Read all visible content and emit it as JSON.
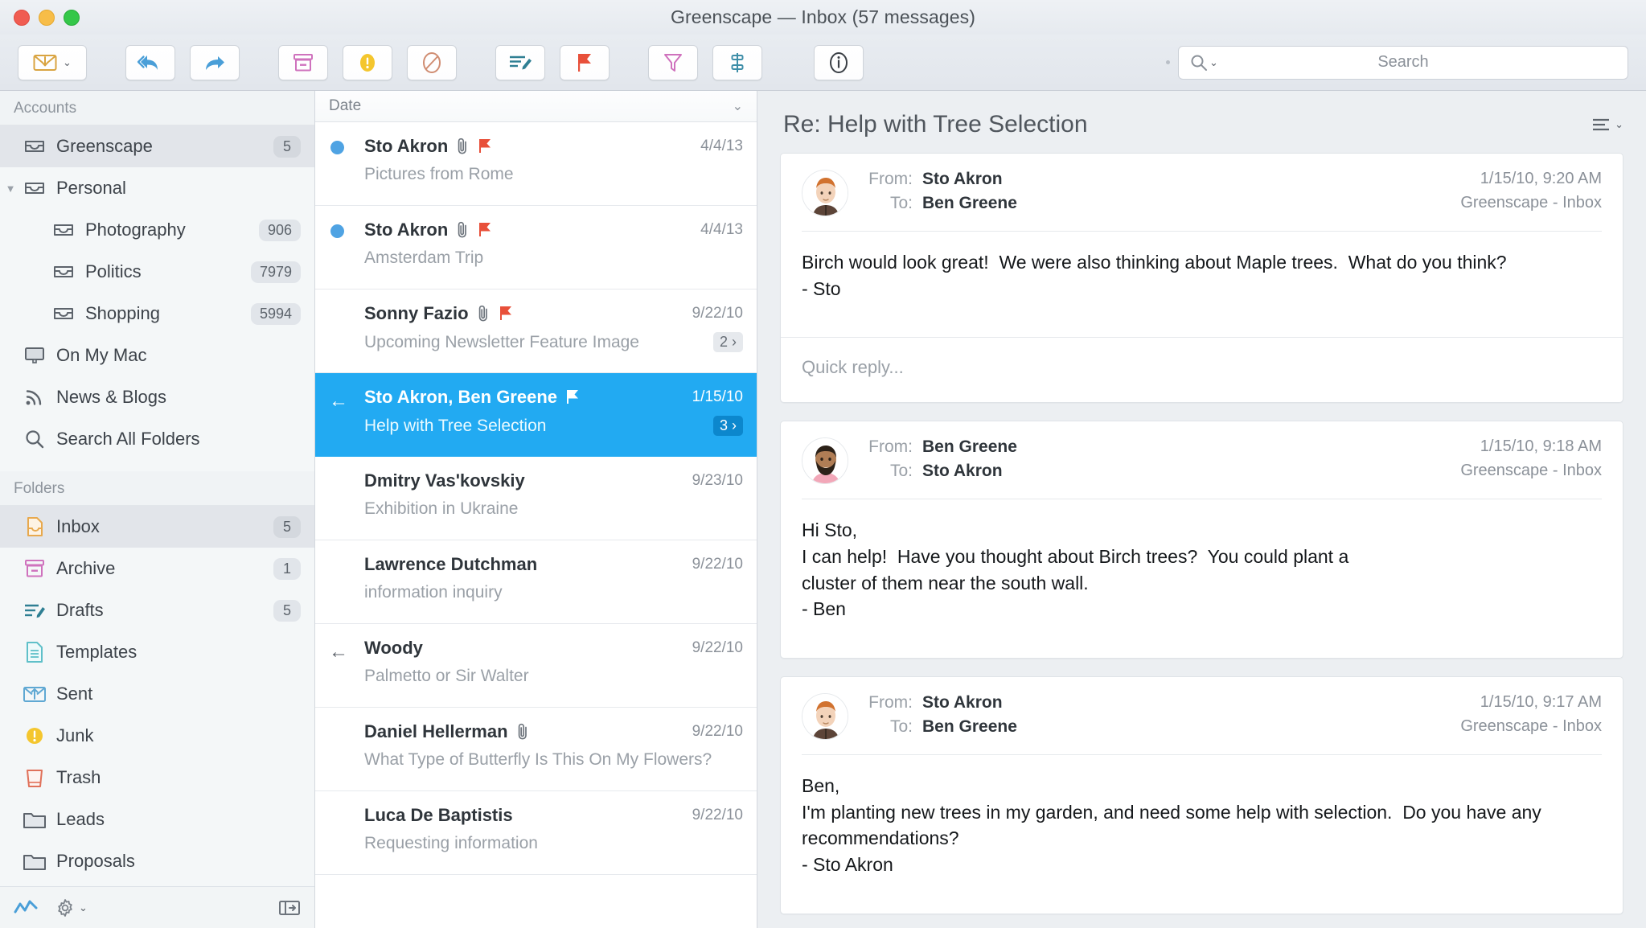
{
  "window": {
    "title": "Greenscape — Inbox (57 messages)",
    "accent_selected": "#22aaf2",
    "traffic": {
      "close": "close-button",
      "minimize": "minimize-button",
      "zoom": "zoom-button"
    }
  },
  "toolbar": {
    "buttons": [
      {
        "name": "get-mail",
        "icon": "envelope-download-icon",
        "has_chevron": true
      },
      {
        "name": "reply-all",
        "icon": "reply-all-icon"
      },
      {
        "name": "forward",
        "icon": "forward-arrow-icon"
      },
      {
        "name": "archive",
        "icon": "archive-box-icon"
      },
      {
        "name": "junk",
        "icon": "junk-warning-icon"
      },
      {
        "name": "block",
        "icon": "block-circle-icon"
      },
      {
        "name": "compose",
        "icon": "compose-pencil-icon"
      },
      {
        "name": "flag",
        "icon": "red-flag-icon"
      },
      {
        "name": "filter",
        "icon": "funnel-filter-icon"
      },
      {
        "name": "sort-threads",
        "icon": "thread-sort-icon"
      },
      {
        "name": "info",
        "icon": "info-circle-icon"
      }
    ],
    "search": {
      "placeholder": "Search",
      "icon": "search-magnifier-icon"
    }
  },
  "sidebar": {
    "accounts_header": "Accounts",
    "folders_header": "Folders",
    "accounts": [
      {
        "label": "Greenscape",
        "badge": "5",
        "icon": "mailbox-tray-icon",
        "indent": 1,
        "selected": true,
        "disclosure": ""
      },
      {
        "label": "Personal",
        "badge": "",
        "icon": "mailbox-tray-icon",
        "indent": 1,
        "selected": false,
        "disclosure": "▼"
      },
      {
        "label": "Photography",
        "badge": "906",
        "icon": "mailbox-tray-icon",
        "indent": 2,
        "selected": false,
        "disclosure": ""
      },
      {
        "label": "Politics",
        "badge": "7979",
        "icon": "mailbox-tray-icon",
        "indent": 2,
        "selected": false,
        "disclosure": ""
      },
      {
        "label": "Shopping",
        "badge": "5994",
        "icon": "mailbox-tray-icon",
        "indent": 2,
        "selected": false,
        "disclosure": ""
      },
      {
        "label": "On My Mac",
        "badge": "",
        "icon": "computer-mac-icon",
        "indent": 1,
        "selected": false,
        "disclosure": ""
      },
      {
        "label": "News & Blogs",
        "badge": "",
        "icon": "rss-feed-icon",
        "indent": 1,
        "selected": false,
        "disclosure": ""
      },
      {
        "label": "Search All Folders",
        "badge": "",
        "icon": "search-magnifier-icon",
        "indent": 1,
        "selected": false,
        "disclosure": ""
      }
    ],
    "folders": [
      {
        "label": "Inbox",
        "badge": "5",
        "icon": "inbox-tray-icon",
        "selected": true
      },
      {
        "label": "Archive",
        "badge": "1",
        "icon": "archive-box-icon",
        "selected": false
      },
      {
        "label": "Drafts",
        "badge": "5",
        "icon": "drafts-pencil-icon",
        "selected": false
      },
      {
        "label": "Templates",
        "badge": "",
        "icon": "template-document-icon",
        "selected": false
      },
      {
        "label": "Sent",
        "badge": "",
        "icon": "sent-envelope-icon",
        "selected": false
      },
      {
        "label": "Junk",
        "badge": "",
        "icon": "junk-warning-icon",
        "selected": false
      },
      {
        "label": "Trash",
        "badge": "",
        "icon": "trash-can-icon",
        "selected": false
      },
      {
        "label": "Leads",
        "badge": "",
        "icon": "folder-icon",
        "selected": false
      },
      {
        "label": "Proposals",
        "badge": "",
        "icon": "folder-icon",
        "selected": false
      }
    ],
    "footer": {
      "activity_icon": "activity-graph-icon",
      "settings_icon": "gear-icon",
      "settings_chevron": "⌄",
      "panel_toggle_icon": "toggle-pane-icon"
    }
  },
  "message_list": {
    "sort_label": "Date",
    "sort_caret_icon": "chevron-down-icon",
    "rows": [
      {
        "sender": "Sto Akron",
        "subject": "Pictures from Rome",
        "date": "4/4/13",
        "unread": true,
        "replied": false,
        "attachment": true,
        "flag": "red",
        "thread_count": "",
        "selected": false
      },
      {
        "sender": "Sto Akron",
        "subject": "Amsterdam Trip",
        "date": "4/4/13",
        "unread": true,
        "replied": false,
        "attachment": true,
        "flag": "red",
        "thread_count": "",
        "selected": false
      },
      {
        "sender": "Sonny Fazio",
        "subject": "Upcoming Newsletter Feature Image",
        "date": "9/22/10",
        "unread": false,
        "replied": false,
        "attachment": true,
        "flag": "red",
        "thread_count": "2",
        "selected": false
      },
      {
        "sender": "Sto Akron, Ben Greene",
        "subject": "Help with Tree Selection",
        "date": "1/15/10",
        "unread": false,
        "replied": true,
        "attachment": false,
        "flag": "white",
        "thread_count": "3",
        "selected": true
      },
      {
        "sender": "Dmitry Vas'kovskiy",
        "subject": "Exhibition in Ukraine",
        "date": "9/23/10",
        "unread": false,
        "replied": false,
        "attachment": false,
        "flag": "",
        "thread_count": "",
        "selected": false
      },
      {
        "sender": "Lawrence Dutchman",
        "subject": "information inquiry",
        "date": "9/22/10",
        "unread": false,
        "replied": false,
        "attachment": false,
        "flag": "",
        "thread_count": "",
        "selected": false
      },
      {
        "sender": "Woody",
        "subject": "Palmetto or Sir Walter",
        "date": "9/22/10",
        "unread": false,
        "replied": true,
        "attachment": false,
        "flag": "",
        "thread_count": "",
        "selected": false
      },
      {
        "sender": "Daniel Hellerman",
        "subject": "What Type of Butterfly Is This On My Flowers?",
        "date": "9/22/10",
        "unread": false,
        "replied": false,
        "attachment": true,
        "flag": "",
        "thread_count": "",
        "selected": false
      },
      {
        "sender": "Luca De Baptistis",
        "subject": "Requesting information",
        "date": "9/22/10",
        "unread": false,
        "replied": false,
        "attachment": false,
        "flag": "",
        "thread_count": "",
        "selected": false
      }
    ]
  },
  "reader": {
    "title": "Re: Help with Tree Selection",
    "menu_icon": "list-menu-icon",
    "from_label": "From:",
    "to_label": "To:",
    "quick_reply_placeholder": "Quick reply...",
    "messages": [
      {
        "from": "Sto Akron",
        "to": "Ben Greene",
        "timestamp": "1/15/10, 9:20 AM",
        "mailbox": "Greenscape - Inbox",
        "avatar": "man-red-hair-avatar",
        "body": "Birch would look great!  We were also thinking about Maple trees.  What do you think?\n- Sto",
        "has_quick_reply": true
      },
      {
        "from": "Ben Greene",
        "to": "Sto Akron",
        "timestamp": "1/15/10, 9:18 AM",
        "mailbox": "Greenscape - Inbox",
        "avatar": "man-beard-avatar",
        "body": "Hi Sto,\nI can help!  Have you thought about Birch trees?  You could plant a\ncluster of them near the south wall.\n- Ben",
        "has_quick_reply": false
      },
      {
        "from": "Sto Akron",
        "to": "Ben Greene",
        "timestamp": "1/15/10, 9:17 AM",
        "mailbox": "Greenscape - Inbox",
        "avatar": "man-red-hair-avatar",
        "body": "Ben,\nI'm planting new trees in my garden, and need some help with selection.  Do you have any\nrecommendations?\n- Sto Akron",
        "has_quick_reply": false
      }
    ]
  }
}
